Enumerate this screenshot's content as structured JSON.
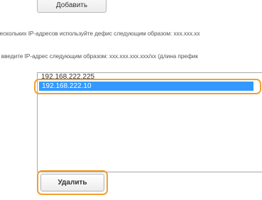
{
  "top_button": {
    "label": "Добавить"
  },
  "hints": {
    "range_hint": "нескольких IP-адресов используйте дефис следующим образом: ххх.ххх.хх",
    "prefix_hint": "а введите IP-адрес следующим образом: ххх.ххх.ххх.ххх/хх (длина префик"
  },
  "ip_list": {
    "items": [
      "192.168.222.225",
      "192.168.222.10"
    ],
    "selected_index": 1
  },
  "delete_button": {
    "label": "Удалить"
  },
  "colors": {
    "selection": "#3399ff",
    "highlight_ring": "#f0a030"
  }
}
